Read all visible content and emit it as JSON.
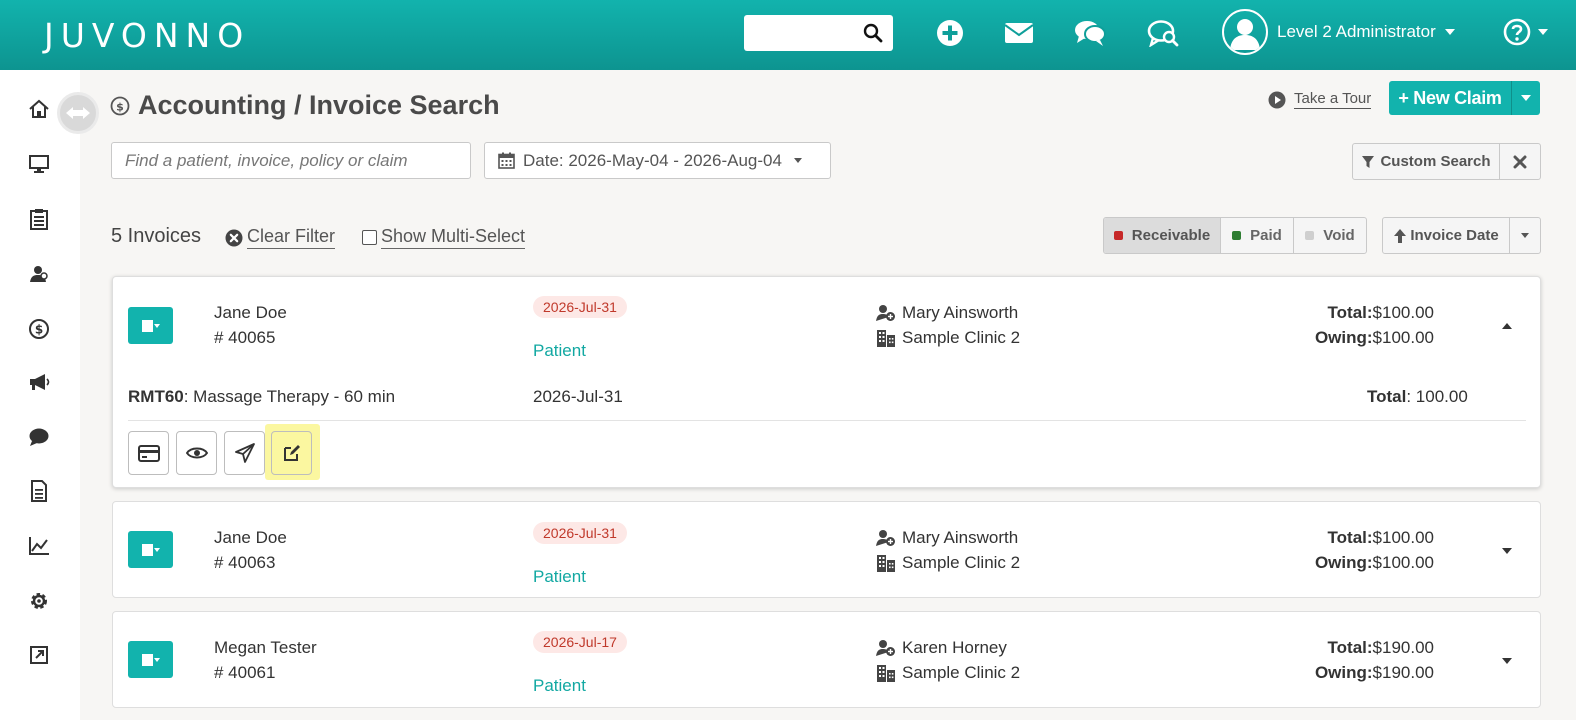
{
  "brand": {
    "logo_text": "JUVONNO"
  },
  "topbar": {
    "search_value": "",
    "user_name": "Level 2 Administrator"
  },
  "page": {
    "title": "Accounting / Invoice Search",
    "take_tour": "Take a Tour",
    "new_claim": "+ New Claim"
  },
  "filters": {
    "find_placeholder": "Find a patient, invoice, policy or claim",
    "date_range": "Date: 2026-May-04 - 2026-Aug-04",
    "custom_search": "Custom Search"
  },
  "summary": {
    "count": "5 Invoices",
    "clear_filter": "Clear Filter",
    "multi_select": "Show Multi-Select",
    "status": [
      {
        "label": "Receivable",
        "color": "#c62828",
        "active": true
      },
      {
        "label": "Paid",
        "color": "#2e7d32",
        "active": false
      },
      {
        "label": "Void",
        "color": "#cfcfcf",
        "active": false
      }
    ],
    "sort_label": "Invoice Date"
  },
  "invoices": [
    {
      "patient": "Jane Doe",
      "number": "# 40065",
      "date": "2026-Jul-31",
      "payer": "Patient",
      "provider": "Mary Ainsworth",
      "clinic": "Sample Clinic 2",
      "total_label": "Total:",
      "total": "$100.00",
      "owing_label": "Owing:",
      "owing": "$100.00",
      "expanded": true,
      "line": {
        "code": "RMT60",
        "desc": ": Massage Therapy - 60 min",
        "date": "2026-Jul-31",
        "total_label": "Total",
        "total": ": 100.00"
      }
    },
    {
      "patient": "Jane Doe",
      "number": "# 40063",
      "date": "2026-Jul-31",
      "payer": "Patient",
      "provider": "Mary Ainsworth",
      "clinic": "Sample Clinic 2",
      "total_label": "Total:",
      "total": "$100.00",
      "owing_label": "Owing:",
      "owing": "$100.00",
      "expanded": false
    },
    {
      "patient": "Megan Tester",
      "number": "# 40061",
      "date": "2026-Jul-17",
      "payer": "Patient",
      "provider": "Karen Horney",
      "clinic": "Sample Clinic 2",
      "total_label": "Total:",
      "total": "$190.00",
      "owing_label": "Owing:",
      "owing": "$190.00",
      "expanded": false
    }
  ],
  "colors": {
    "brand_teal": "#12b3ad",
    "date_pill_bg": "#fde8e6",
    "date_pill_text": "#c0392b",
    "highlight": "#fbf7a0"
  }
}
